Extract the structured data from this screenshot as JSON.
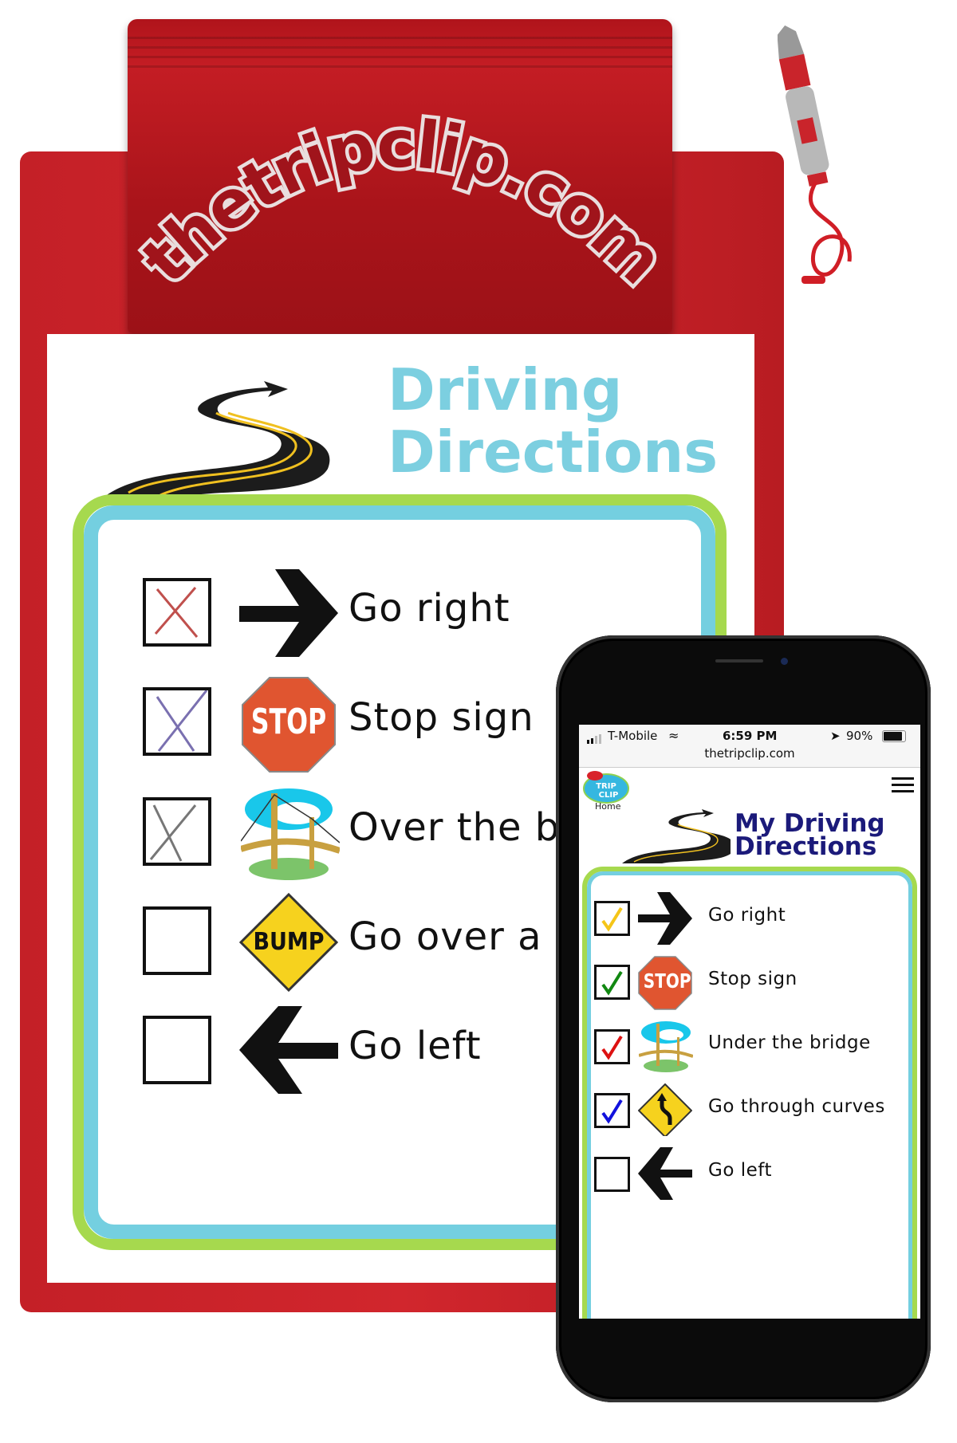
{
  "clipboard": {
    "logo_text": "thetripclip.com",
    "title_line1": "Driving",
    "title_line2": "Directions",
    "colors": {
      "board": "#c42027",
      "title": "#7ccfe0",
      "frame_outer": "#a6d94e",
      "frame_inner": "#74cfe0"
    },
    "items": [
      {
        "label": "Go right",
        "icon": "arrow-right-icon",
        "mark": "x",
        "mark_color": "#c0504d"
      },
      {
        "label": "Stop sign",
        "icon": "stop-sign-icon",
        "icon_text": "STOP",
        "mark": "x",
        "mark_color": "#7a70b0"
      },
      {
        "label": "Over the br",
        "icon": "bridge-icon",
        "mark": "x",
        "mark_color": "#777777"
      },
      {
        "label": "Go over a b",
        "icon": "bump-sign-icon",
        "icon_text": "BUMP",
        "mark": "none"
      },
      {
        "label": "Go left",
        "icon": "arrow-left-icon",
        "mark": "none"
      }
    ]
  },
  "phone": {
    "status": {
      "carrier": "T-Mobile",
      "time": "6:59 PM",
      "battery": "90%",
      "url": "thetripclip.com"
    },
    "header": {
      "logo_text": "THE TRIP CLIP",
      "home_label": "Home",
      "menu_icon": "hamburger-menu-icon"
    },
    "title_line1": "My Driving",
    "title_line2": "Directions",
    "title_color": "#1b1a7a",
    "items": [
      {
        "label": "Go right",
        "icon": "arrow-right-icon",
        "checked": true,
        "check_color": "#f5c518"
      },
      {
        "label": "Stop sign",
        "icon": "stop-sign-icon",
        "icon_text": "STOP",
        "checked": true,
        "check_color": "#118811"
      },
      {
        "label": "Under the bridge",
        "icon": "bridge-icon",
        "checked": true,
        "check_color": "#dd1111"
      },
      {
        "label": "Go through curves",
        "icon": "curves-sign-icon",
        "checked": true,
        "check_color": "#1111dd"
      },
      {
        "label": "Go left",
        "icon": "arrow-left-icon",
        "checked": false
      }
    ]
  }
}
